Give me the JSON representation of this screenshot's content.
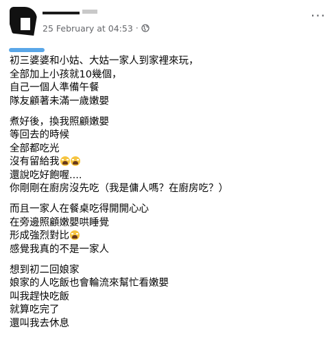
{
  "post": {
    "timestamp": "25 February at 04:53",
    "separator": "·",
    "more_label": "···",
    "paragraphs": [
      [
        "初三婆婆和小姑、大姑一家人到家裡來玩，",
        "全部加上小孩就10幾個，",
        "自己一個人準備午餐",
        "隊友顧著未滿一歲嫩嬰"
      ],
      [
        "煮好後，換我照顧嫩嬰",
        "等回去的時候",
        "全部都吃光",
        "沒有留給我",
        "還說吃好飽喔....",
        "你剛剛在廚房沒先吃（我是傭人嗎？在廚房吃？）"
      ],
      [
        "而且一家人在餐桌吃得開開心心",
        "在旁邊照顧嫩嬰哄睡覺",
        "形成強烈對比",
        "感覺我真的不是一家人"
      ],
      [
        "想到初二回娘家",
        "娘家的人吃飯也會輪流來幫忙看嫩嬰",
        "叫我趕快吃飯",
        "就算吃完了",
        "還叫我去休息"
      ]
    ]
  },
  "icons": {
    "privacy": "globe-icon",
    "reaction": "crying-face-emoji"
  }
}
